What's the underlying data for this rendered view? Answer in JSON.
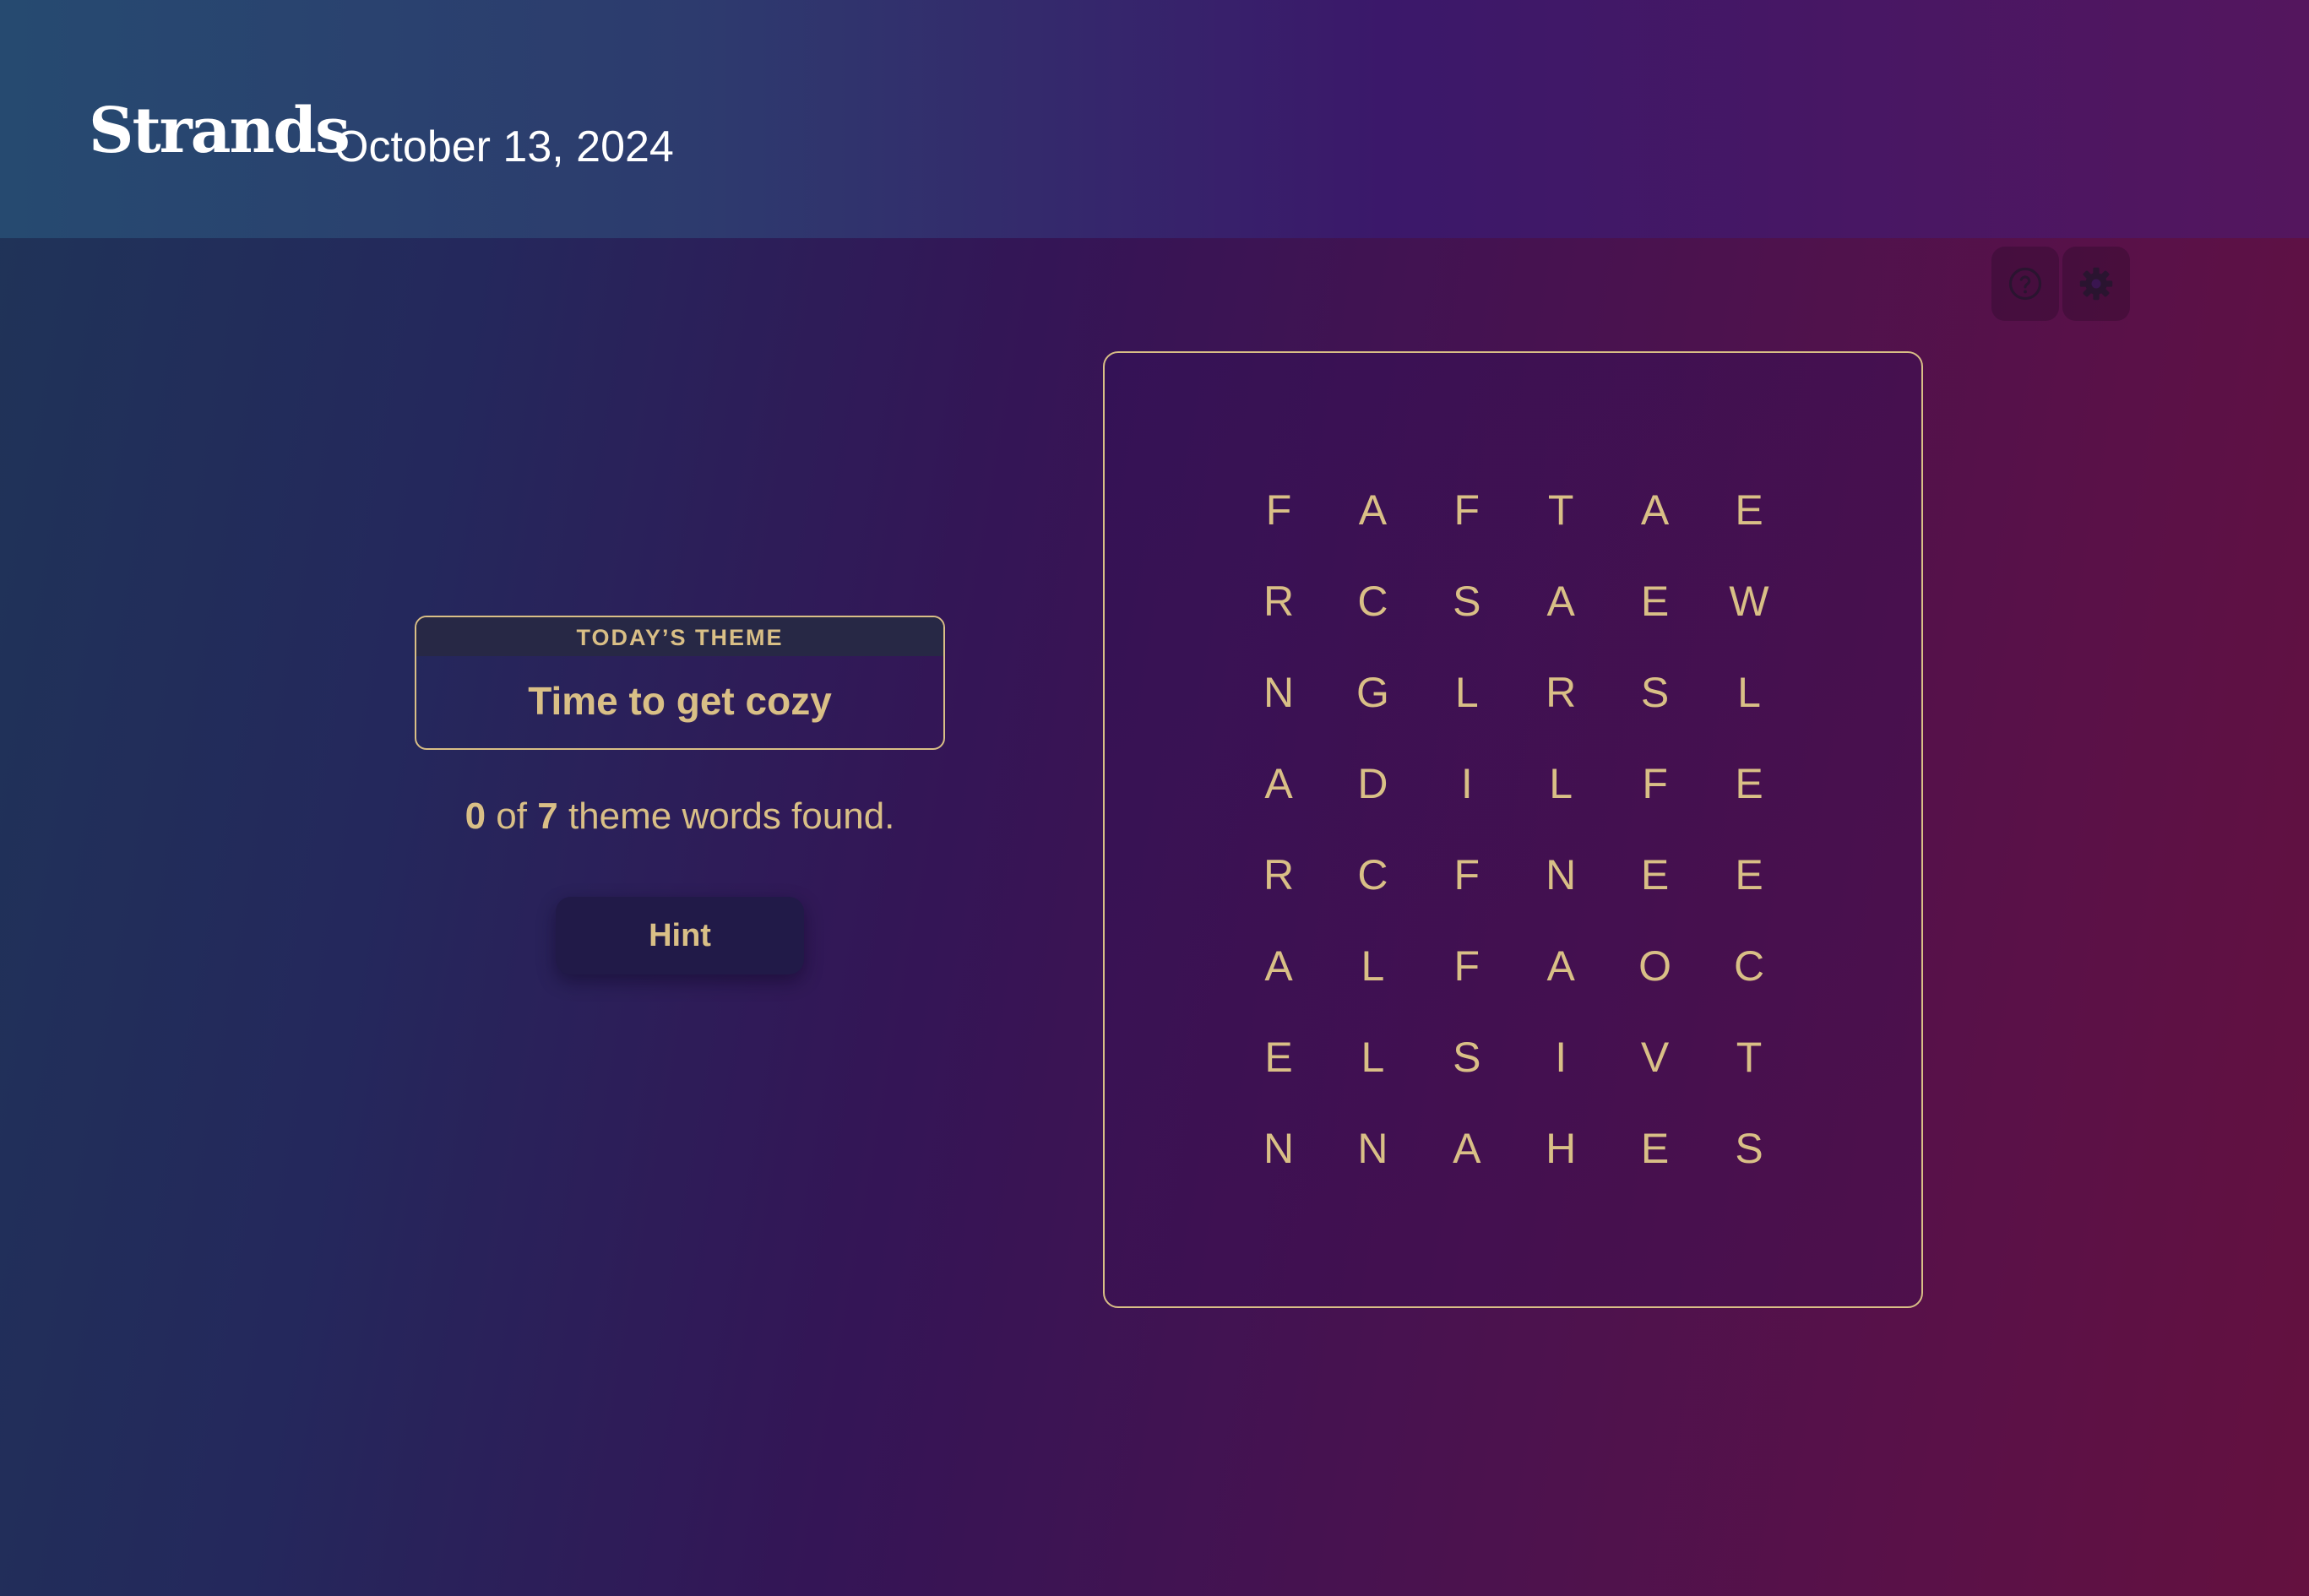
{
  "header": {
    "brand": "Strands",
    "date": "October 13, 2024"
  },
  "toolbar": {
    "help_icon": "help-circle-icon",
    "settings_icon": "gear-icon"
  },
  "theme": {
    "label": "TODAY’S THEME",
    "title": "Time to get cozy"
  },
  "progress": {
    "found": "0",
    "of_text": " of ",
    "total": "7",
    "suffix": " theme words found."
  },
  "hint_button": {
    "label": "Hint"
  },
  "board": {
    "rows": [
      [
        "F",
        "A",
        "F",
        "T",
        "A",
        "E"
      ],
      [
        "R",
        "C",
        "S",
        "A",
        "E",
        "W"
      ],
      [
        "N",
        "G",
        "L",
        "R",
        "S",
        "L"
      ],
      [
        "A",
        "D",
        "I",
        "L",
        "F",
        "E"
      ],
      [
        "R",
        "C",
        "F",
        "N",
        "E",
        "E"
      ],
      [
        "A",
        "L",
        "F",
        "A",
        "O",
        "C"
      ],
      [
        "E",
        "L",
        "S",
        "I",
        "V",
        "T"
      ],
      [
        "N",
        "N",
        "A",
        "H",
        "E",
        "S"
      ]
    ]
  },
  "colors": {
    "accent": "#d9bf86",
    "header_bg": "#2d3b6e",
    "hint_bg": "#211a48"
  }
}
